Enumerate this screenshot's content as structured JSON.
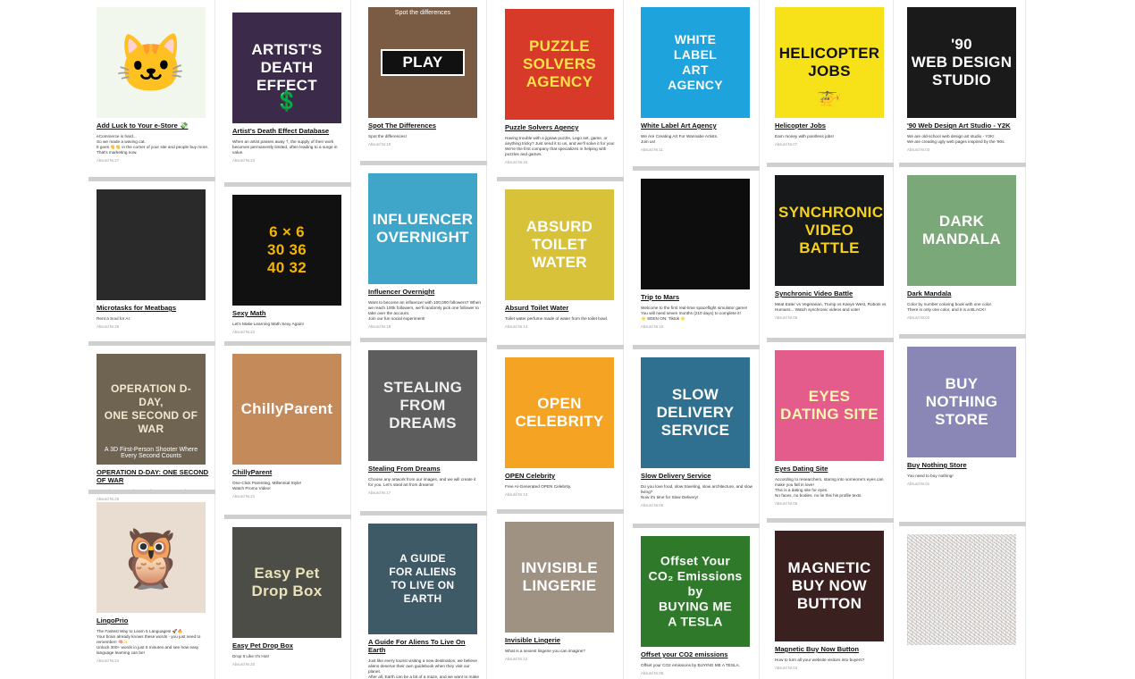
{
  "columns": [
    {
      "cards": [
        {
          "title": "Add Luck to Your e-Store 💸",
          "desc": "eCommerce is hard...\nSo we made a waving cat.\nIt goes 👋👋 in the corner of your site and people buy more.\nThat's marketing now.",
          "meta": "Absurd Nr.27",
          "thumb_text": "",
          "bg": "#f2f7ee",
          "fg": "#111",
          "emoji": "🐱"
        },
        {
          "title": "Microtasks for Meatbags",
          "desc": "Rent a Soul for AI.",
          "meta": "Absurd Nr.26",
          "thumb_text": "",
          "bg": "#2a2a2a",
          "fg": "#fff",
          "emoji": ""
        },
        {
          "title": "OPERATION D-DAY: ONE SECOND OF WAR",
          "desc": "A 3D First-Person Shooter Where Every Second Counts.",
          "meta": "Absurd Nr.25",
          "thumb_text": "OPERATION D-DAY,\nONE SECOND OF WAR",
          "thumb_sub": "A 3D First-Person Shooter Where Every Second Counts",
          "bg": "#6f6452",
          "fg": "#f3e8cf",
          "emoji": ""
        },
        {
          "title": "LingoPrio",
          "desc": "The Fastest Way to Learn 5 Languages! 🚀🔥\nYour brain already knows these words - you just need to remember! 🧠✨\nUnlock 300+ words in just 5 minutes and see how easy language learning can be!",
          "meta": "Absurd Nr.24",
          "thumb_text": "",
          "bg": "#e9dcd0",
          "fg": "#333",
          "emoji": "🦉"
        }
      ]
    },
    {
      "cards": [
        {
          "title": "Artist's Death Effect Database",
          "desc": "When an artist passes away †, the supply of their work becomes permanently limited, often leading to a surge in value.",
          "meta": "Absurd Nr.23",
          "thumb_text": "ARTIST'S DEATH EFFECT",
          "bg": "#3b2a4a",
          "fg": "#fff",
          "emoji": "💲"
        },
        {
          "title": "Sexy Math",
          "desc": "Let's Make Learning Math Sexy Again!",
          "meta": "Absurd Nr.22",
          "thumb_text": "6 × 6\n30   36\n40   32",
          "bg": "#111",
          "fg": "#f5b400",
          "emoji": ""
        },
        {
          "title": "ChillyParent",
          "desc": "One-Click Parenting, Millennial Style!\nWatch Promo Video!",
          "meta": "Absurd Nr.21",
          "thumb_text": "ChillyParent",
          "bg": "#c58a5a",
          "fg": "#fff",
          "emoji": ""
        },
        {
          "title": "Easy Pet Drop Box",
          "desc": "Drop It Like It's Hot!",
          "meta": "Absurd Nr.20",
          "thumb_text": "Easy Pet Drop Box",
          "bg": "#4d4d48",
          "fg": "#e9e2b8",
          "emoji": ""
        }
      ]
    },
    {
      "cards": [
        {
          "title": "Spot The Differences",
          "desc": "Spot the differences!",
          "meta": "Absurd Nr.19",
          "thumb_text": "PLAY",
          "thumb_top": "Spot the differences",
          "bg": "#7a5c44",
          "fg": "#fff",
          "emoji": ""
        },
        {
          "title": "Influencer Overnight",
          "desc": "Want to become an influencer with 100,000 followers? When we reach 100k followers, we'll randomly pick one follower to take over the account.\nJoin our fun social experiment!",
          "meta": "Absurd Nr.18",
          "thumb_text": "INFLUENCER\nOVERNIGHT",
          "bg": "#3fa6c9",
          "fg": "#ffffff",
          "emoji": ""
        },
        {
          "title": "Stealing From Dreams",
          "desc": "Choose any artwork from our images, and we will create it for you. Let's steal art from dreams!",
          "meta": "Absurd Nr.17",
          "thumb_text": "STEALING FROM\nDREAMS",
          "bg": "#5d5d5d",
          "fg": "#f0f0f0",
          "emoji": ""
        },
        {
          "title": "A Guide For Aliens To Live On Earth",
          "desc": "Just like every tourist visiting a new destination, we believe aliens deserve their own guidebook when they visit our planet.\nAfter all, Earth can be a bit of a maze, and we want to make sure our extraterrestrial guests have all the insider tips and tricks they need to navigate with ease and enjoy their cosmic",
          "meta": "",
          "thumb_text": "A GUIDE\nFOR ALIENS\nTO LIVE ON EARTH",
          "bg": "#3d5a66",
          "fg": "#ffffff",
          "emoji": ""
        }
      ]
    },
    {
      "cards": [
        {
          "title": "Puzzle Solvers Agency",
          "desc": "Having trouble with a jigsaw puzzle, Lego set, game, or anything tricky? Just send it to us, and we'll solve it for you!\nWe're the first company that specializes in helping with puzzles and games.",
          "meta": "Absurd Nr.15",
          "thumb_text": "PUZZLE\nSOLVERS\nAGENCY",
          "bg": "#d83a2a",
          "fg": "#ffe14a",
          "emoji": ""
        },
        {
          "title": "Absurd Toilet Water",
          "desc": "Toilet water perfume made of water from the toilet bowl.",
          "meta": "Absurd Nr.14",
          "thumb_text": "ABSURD\nTOILET\nWATER",
          "bg": "#d8c23a",
          "fg": "#ffffff",
          "emoji": ""
        },
        {
          "title": "OPEN Celebrity",
          "desc": "Free AI-Generated OPEN Celebrity.",
          "meta": "Absurd Nr.13",
          "thumb_text": "OPEN\nCELEBRITY",
          "bg": "#f4a322",
          "fg": "#ffffff",
          "emoji": ""
        },
        {
          "title": "Invisible Lingerie",
          "desc": "What is a sexiest lingerie you can imagine?",
          "meta": "Absurd Nr.12",
          "thumb_text": "INVISIBLE\nLINGERIE",
          "bg": "#a09283",
          "fg": "#ffffff",
          "emoji": ""
        }
      ]
    },
    {
      "cards": [
        {
          "title": "White Label Art Agency",
          "desc": "We Are Creating Art For Wannabe Artists.\nJoin us!",
          "meta": "Absurd Nr.11",
          "thumb_text": "WHITE\nLABEL\nART\nAGENCY",
          "bg": "#1fa3dc",
          "fg": "#ffffff",
          "emoji": ""
        },
        {
          "title": "Trip to Mars",
          "desc": "Welcome to the first real-time spaceflight simulator game! You will need seven months (210 days) to complete it!\n⭐ SEEN ON: Tiktok ⭐",
          "meta": "Absurd Nr.10",
          "thumb_text": "",
          "bg": "#0d0d0d",
          "fg": "#fff",
          "emoji": ""
        },
        {
          "title": "Slow Delivery Service",
          "desc": "Do you love food, slow traveling, slow architecture, and slow living?\nNow it's time for Slow Delivery!",
          "meta": "Absurd Nr.09",
          "thumb_text": "SLOW\nDELIVERY\nSERVICE",
          "bg": "#2f6f8f",
          "fg": "#ffffff",
          "emoji": ""
        },
        {
          "title": "Offset your CO2 emissions",
          "desc": "Offset your CO2 emissions by BUYING ME A TESLA.",
          "meta": "Absurd Nr.08",
          "thumb_text": "Offset Your\nCO₂ Emissions\nby\nBUYING ME\nA TESLA",
          "bg": "#2e7a2a",
          "fg": "#ffffff",
          "emoji": ""
        }
      ]
    },
    {
      "cards": [
        {
          "title": "Helicopter Jobs",
          "desc": "Earn money with pointless jobs!",
          "meta": "Absurd Nr.07",
          "thumb_text": "HELICOPTER\nJOBS",
          "bg": "#f7e21a",
          "fg": "#111111",
          "emoji": "🚁"
        },
        {
          "title": "Synchronic Video Battle",
          "desc": "Meat Eater vs Vegetarian, Trump vs Kanye West, Robots vs Humans... Watch synchronic videos and vote!",
          "meta": "Absurd Nr.06",
          "thumb_text": "SYNCHRONIC\nVIDEO\nBATTLE",
          "bg": "#17181a",
          "fg": "#f7d21a",
          "emoji": ""
        },
        {
          "title": "Eyes Dating Site",
          "desc": "According to researchers, staring into someone's eyes can make you fall in love!\nThis is a dating site for eyes.\nNo faces, no bodies, no lie this his profile texts.",
          "meta": "Absurd Nr.05",
          "thumb_text": "EYES\nDATING SITE",
          "bg": "#e45c8c",
          "fg": "#fff6b0",
          "emoji": ""
        },
        {
          "title": "Magnetic Buy Now Button",
          "desc": "How to turn all your website visitors into buyers?",
          "meta": "Absurd Nr.04",
          "thumb_text": "MAGNETIC\nBUY NOW\nBUTTON",
          "bg": "#3b2020",
          "fg": "#ffffff",
          "emoji": ""
        }
      ]
    },
    {
      "cards": [
        {
          "title": "'90 Web Design Art Studio - Y2K",
          "desc": "We are old-school web design art studio - Y2K!\nWe are creating ugly web pages inspired by the '90s.",
          "meta": "Absurd Nr.03",
          "thumb_text": "'90\nWEB DESIGN\nSTUDIO",
          "bg": "#1a1a1a",
          "fg": "#ffffff",
          "emoji": ""
        },
        {
          "title": "Dark Mandala",
          "desc": "Color by number coloring book with one color.\nThere is only one color, and it is a BLACK!",
          "meta": "Absurd Nr.02",
          "thumb_text": "DARK\nMANDALA",
          "bg": "#7aa879",
          "fg": "#ffffff",
          "emoji": ""
        },
        {
          "title": "Buy Nothing Store",
          "desc": "You need to buy nothing!",
          "meta": "Absurd Nr.01",
          "thumb_text": "BUY\nNOTHING\nSTORE",
          "bg": "#8a86b6",
          "fg": "#ffffff",
          "emoji": ""
        },
        {
          "title": "",
          "desc": "",
          "meta": "",
          "thumb_text": "",
          "bg": "noise",
          "fg": "#fff",
          "emoji": ""
        }
      ]
    }
  ]
}
